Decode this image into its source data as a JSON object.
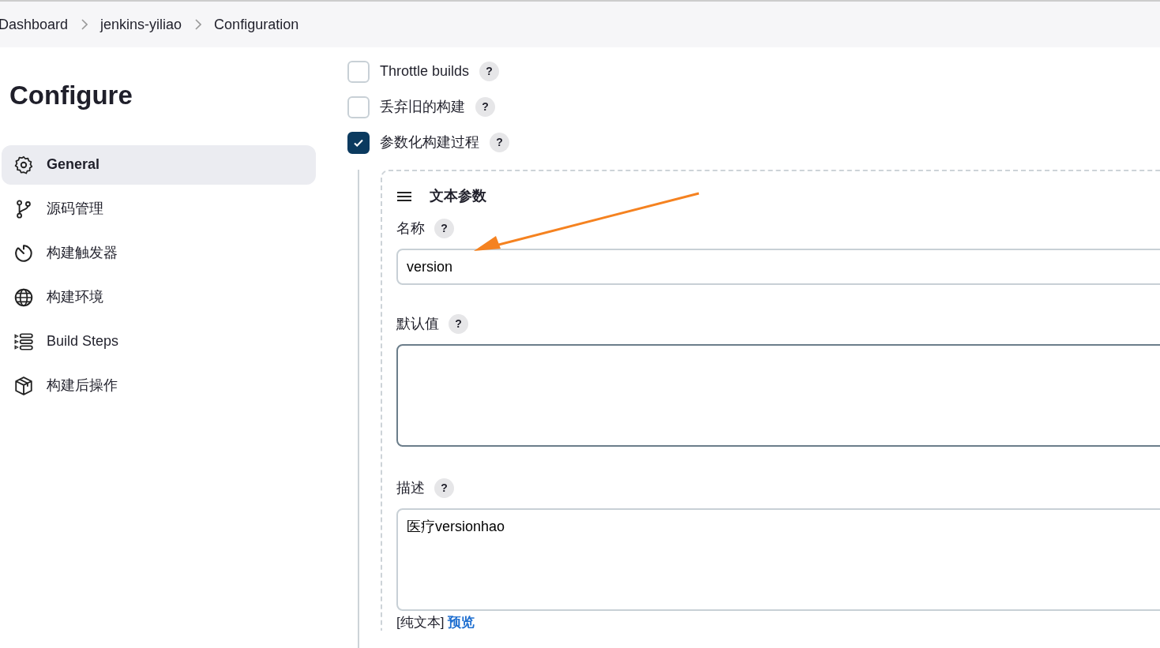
{
  "breadcrumbs": [
    "Dashboard",
    "jenkins-yiliao",
    "Configuration"
  ],
  "page_title": "Configure",
  "sidebar": {
    "items": [
      {
        "label": "General",
        "selected": true
      },
      {
        "label": "源码管理",
        "selected": false
      },
      {
        "label": "构建触发器",
        "selected": false
      },
      {
        "label": "构建环境",
        "selected": false
      },
      {
        "label": "Build Steps",
        "selected": false
      },
      {
        "label": "构建后操作",
        "selected": false
      }
    ]
  },
  "options": [
    {
      "label": "Throttle builds",
      "help": "?",
      "checked": false
    },
    {
      "label": "丢弃旧的构建",
      "help": "?",
      "checked": false
    },
    {
      "label": "参数化构建过程",
      "help": "?",
      "checked": true
    }
  ],
  "parameter": {
    "title": "文本参数",
    "fields": [
      {
        "kind": "input",
        "label": "名称",
        "help": "?",
        "value": "version"
      },
      {
        "kind": "textarea",
        "label": "默认值",
        "help": "?"
      },
      {
        "kind": "textarea",
        "label": "描述",
        "help": "?",
        "value": "医疗versionhao"
      }
    ],
    "format_note": "[纯文本]",
    "preview_link": "预览"
  }
}
